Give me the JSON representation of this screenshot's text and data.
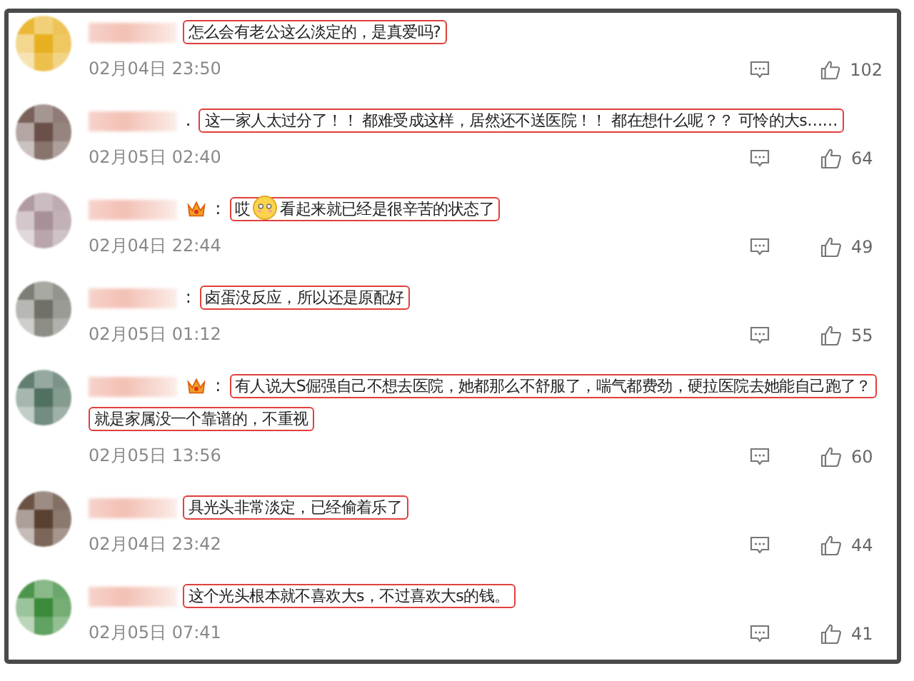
{
  "comments": [
    {
      "color": "#e8b020",
      "badge": false,
      "comment": [
        {
          "kind": "text",
          "text": "怎么会有老公这么淡定的，是真爱吗?"
        }
      ],
      "time": "02月04日 23:50",
      "likes": "102"
    },
    {
      "color": "#6a5048",
      "badge": false,
      "colon": ".",
      "comment": [
        {
          "kind": "text",
          "text": "这一家人太过分了！！ 都难受成这样，居然还不送医院！！ 都在想什么呢？？ 可怜的大s……"
        }
      ],
      "time": "02月05日 02:40",
      "likes": "64"
    },
    {
      "color": "#a89098",
      "badge": true,
      "colon": ":",
      "comment": [
        {
          "kind": "text",
          "text": "哎"
        },
        {
          "kind": "emoji"
        },
        {
          "kind": "text",
          "text": "看起来就已经是很辛苦的状态了"
        }
      ],
      "time": "02月04日 22:44",
      "likes": "49"
    },
    {
      "color": "#707068",
      "badge": false,
      "colon": ":",
      "comment": [
        {
          "kind": "text",
          "text": "卤蛋没反应，所以还是原配好"
        }
      ],
      "time": "02月05日 01:12",
      "likes": "55"
    },
    {
      "color": "#507060",
      "badge": true,
      "colon": ":",
      "comment": [
        {
          "kind": "text",
          "text": "有人说大S倔强自己不想去医院，她都那么不舒服了，喘气都费劲，硬拉医院去她能自己跑了？就是家属没一个靠谱的，不重视"
        }
      ],
      "time": "02月05日 13:56",
      "likes": "60"
    },
    {
      "color": "#5a4030",
      "badge": false,
      "comment": [
        {
          "kind": "text",
          "text": "具光头非常淡定，已经偷着乐了"
        }
      ],
      "time": "02月04日 23:42",
      "likes": "44"
    },
    {
      "color": "#3a8a3a",
      "badge": false,
      "comment": [
        {
          "kind": "text",
          "text": "这个光头根本就不喜欢大s，不过喜欢大s的钱。"
        }
      ],
      "time": "02月05日 07:41",
      "likes": "41"
    }
  ]
}
